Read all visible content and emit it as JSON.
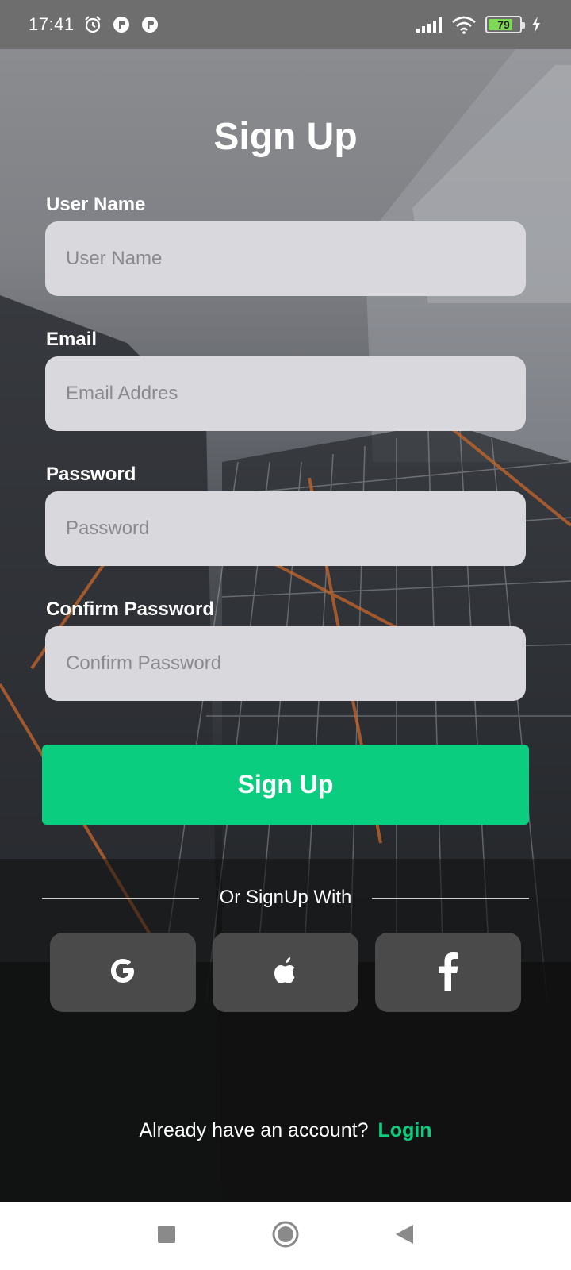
{
  "status_bar": {
    "time": "17:41",
    "battery_level": "79",
    "battery_fraction": 0.79,
    "icons": [
      "alarm-icon",
      "app-notification-icon",
      "app-notification-icon",
      "signal-icon",
      "wifi-icon",
      "battery-icon",
      "charging-icon"
    ]
  },
  "form": {
    "title": "Sign Up",
    "fields": [
      {
        "label": "User Name",
        "placeholder": "User Name",
        "value": ""
      },
      {
        "label": "Email",
        "placeholder": "Email Addres",
        "value": ""
      },
      {
        "label": "Password",
        "placeholder": "Password",
        "value": ""
      },
      {
        "label": "Confirm Password",
        "placeholder": "Confirm Password",
        "value": ""
      }
    ],
    "submit_label": "Sign Up"
  },
  "social": {
    "divider_text": "Or SignUp With",
    "providers": [
      {
        "name": "google",
        "icon": "google-icon"
      },
      {
        "name": "apple",
        "icon": "apple-icon"
      },
      {
        "name": "facebook",
        "icon": "facebook-icon"
      }
    ]
  },
  "footer": {
    "prompt": "Already have an account?",
    "login_label": "Login"
  },
  "nav_bar": {
    "buttons": [
      "recents-icon",
      "home-icon",
      "back-icon"
    ]
  },
  "colors": {
    "accent": "#0bcd80",
    "field_bg": "#d9d8dd",
    "social_bg": "#4a4a4a",
    "background": "#111111"
  }
}
